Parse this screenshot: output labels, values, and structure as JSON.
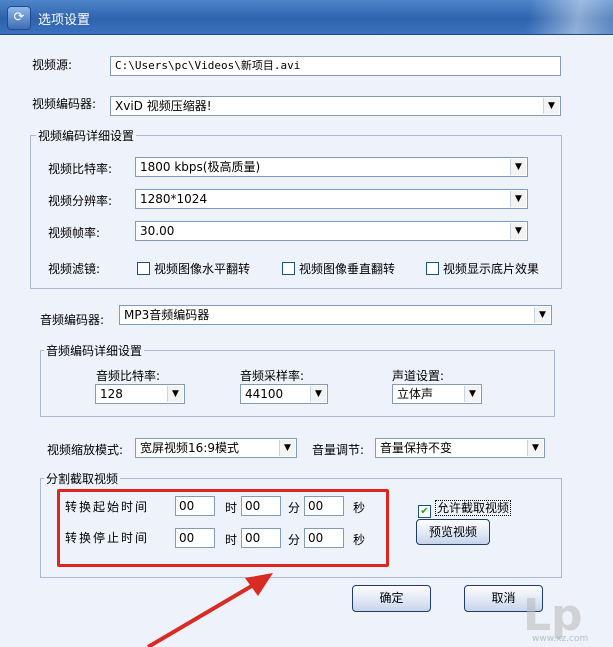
{
  "window": {
    "title": "选项设置"
  },
  "video": {
    "source_label": "视频源:",
    "source_value": "C:\\Users\\pc\\Videos\\新项目.avi",
    "encoder_label": "视频编码器:",
    "encoder_value": "XviD 视频压缩器!",
    "detail_group": "视频编码详细设置",
    "bitrate_label": "视频比特率:",
    "bitrate_value": "1800 kbps(极高质量)",
    "resolution_label": "视频分辨率:",
    "resolution_value": "1280*1024",
    "framerate_label": "视频帧率:",
    "framerate_value": "30.00",
    "filter_label": "视频滤镜:",
    "filters": [
      "视频图像水平翻转",
      "视频图像垂直翻转",
      "视频显示底片效果"
    ]
  },
  "audio": {
    "encoder_label": "音频编码器:",
    "encoder_value": "MP3音频编码器",
    "detail_group": "音频编码详细设置",
    "bitrate_label": "音频比特率:",
    "bitrate_value": "128",
    "samplerate_label": "音频采样率:",
    "samplerate_value": "44100",
    "channel_label": "声道设置:",
    "channel_value": "立体声"
  },
  "scale": {
    "mode_label": "视频缩放模式:",
    "mode_value": "宽屏视频16:9模式",
    "volume_label": "音量调节:",
    "volume_value": "音量保持不变"
  },
  "split": {
    "group": "分割截取视频",
    "start_label": "转换起始时间",
    "end_label": "转换停止时间",
    "hour": "时",
    "minute": "分",
    "second": "秒",
    "start": {
      "h": "00",
      "m": "00",
      "s": "00"
    },
    "end": {
      "h": "00",
      "m": "00",
      "s": "00"
    },
    "allow_label": "允许截取视频",
    "preview_button": "预览视频"
  },
  "buttons": {
    "ok": "确定",
    "cancel": "取消"
  },
  "watermark": {
    "text": "Lp",
    "sub": "www.xz.com"
  }
}
